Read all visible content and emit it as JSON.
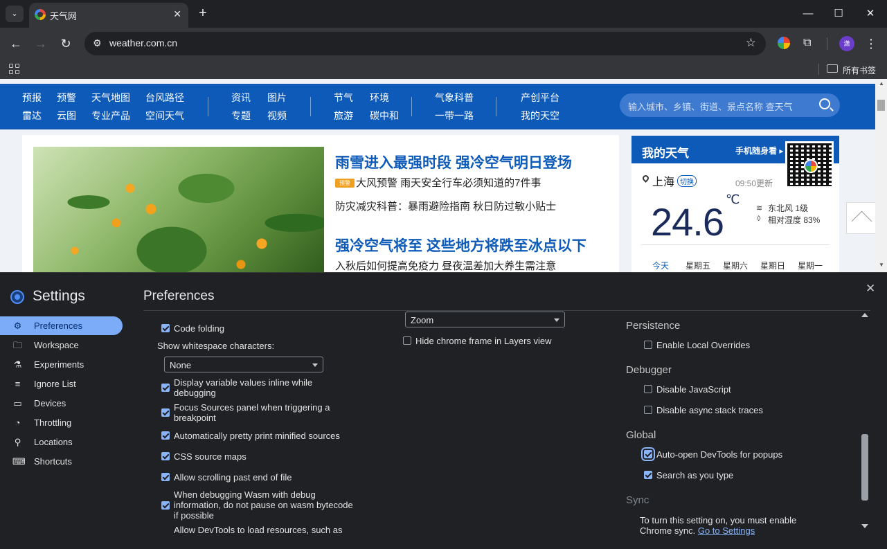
{
  "browser": {
    "tab_title": "天气网",
    "new_tab": "+",
    "url": "weather.com.cn",
    "profile_initial": "潇",
    "all_bookmarks": "所有书签"
  },
  "site": {
    "nav": {
      "col1": [
        "预报",
        "雷达"
      ],
      "col2": [
        "预警",
        "云图"
      ],
      "col3": [
        "天气地图",
        "专业产品"
      ],
      "col4": [
        "台风路径",
        "空间天气"
      ],
      "col5": [
        "资讯",
        "专题"
      ],
      "col6": [
        "图片",
        "视频"
      ],
      "col7": [
        "节气",
        "旅游"
      ],
      "col8": [
        "环境",
        "碳中和"
      ],
      "col9": [
        "气象科普",
        "一带一路"
      ],
      "col10": [
        "产创平台",
        "我的天空"
      ]
    },
    "search_placeholder": "输入城市、乡镇、街道、景点名称 查天气",
    "news": {
      "headline1": "雨雪进入最强时段 强冷空气明日登场",
      "badge": "预警",
      "line1": "大风预警 雨天安全行车必须知道的7件事",
      "line2": "防灾减灾科普：暴雨避险指南 秋日防过敏小贴士",
      "headline2": "强冷空气将至 这些地方将跌至冰点以下",
      "line3": "入秋后如何提高免疫力 昼夜温差加大养生需注意"
    },
    "my_weather": {
      "title": "我的天气",
      "mobile": "手机随身看 ▸",
      "city": "上海",
      "switch": "切换",
      "updated": "09:50更新",
      "temperature": "24.6",
      "unit": "℃",
      "wind": "东北风 1级",
      "humidity": "相对湿度 83%",
      "days": [
        "今天",
        "星期五",
        "星期六",
        "星期日",
        "星期一"
      ]
    }
  },
  "devtools": {
    "title": "Settings",
    "close": "✕",
    "heading": "Preferences",
    "sidebar": [
      {
        "label": "Preferences",
        "icon": "gear-icon",
        "glyph": "⚙"
      },
      {
        "label": "Workspace",
        "icon": "folder-icon",
        "glyph": "🗀"
      },
      {
        "label": "Experiments",
        "icon": "flask-icon",
        "glyph": "⚗"
      },
      {
        "label": "Ignore List",
        "icon": "ignore-list-icon",
        "glyph": "≡"
      },
      {
        "label": "Devices",
        "icon": "devices-icon",
        "glyph": "▭"
      },
      {
        "label": "Throttling",
        "icon": "gauge-icon",
        "glyph": "◔"
      },
      {
        "label": "Locations",
        "icon": "location-pin-icon",
        "glyph": "⚲"
      },
      {
        "label": "Shortcuts",
        "icon": "keyboard-icon",
        "glyph": "⌨"
      }
    ],
    "col1": {
      "code_folding": "Code folding",
      "whitespace_label": "Show whitespace characters:",
      "whitespace_value": "None",
      "inline_values": "Display variable values inline while debugging",
      "focus_sources": "Focus Sources panel when triggering a breakpoint",
      "pretty_print": "Automatically pretty print minified sources",
      "css_source_maps": "CSS source maps",
      "scroll_past_end": "Allow scrolling past end of file",
      "wasm_debug": "When debugging Wasm with debug information, do not pause on wasm bytecode if possible",
      "allow_resources": "Allow DevTools to load resources, such as"
    },
    "col2": {
      "zoom_value": "Zoom",
      "hide_chrome_frame": "Hide chrome frame in Layers view"
    },
    "col3": {
      "persistence": "Persistence",
      "local_overrides": "Enable Local Overrides",
      "debugger": "Debugger",
      "disable_js": "Disable JavaScript",
      "disable_async": "Disable async stack traces",
      "global": "Global",
      "auto_open": "Auto-open DevTools for popups",
      "search_as_type": "Search as you type",
      "sync": "Sync",
      "sync_text": "To turn this setting on, you must enable Chrome sync.",
      "go_to_settings": "Go to Settings"
    }
  }
}
